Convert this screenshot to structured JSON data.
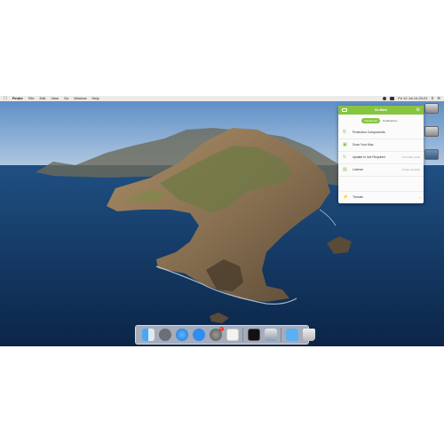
{
  "menubar": {
    "app_name": "Finder",
    "items": [
      "File",
      "Edit",
      "View",
      "Go",
      "Window",
      "Help"
    ],
    "clock": "Fri 12 Jul  14:23:21"
  },
  "drweb": {
    "title": "Dr.Web",
    "tabs": [
      "Dashboard",
      "Notifications"
    ],
    "rows": [
      {
        "label": "Protection Components",
        "meta": ""
      },
      {
        "label": "Scan Your Mac",
        "meta": ""
      },
      {
        "label": "Update Is Not Required",
        "meta": "15.07.2020, 16:30"
      },
      {
        "label": "License",
        "meta": "44 days remaining"
      },
      {
        "label": "Threats",
        "meta": ""
      }
    ],
    "accent": "#86c540"
  },
  "dock": {
    "icons": [
      "finder-icon",
      "launchpad-icon",
      "safari-icon",
      "app-store-icon",
      "system-preferences-icon",
      "drweb-icon",
      "terminal-icon",
      "preview-icon",
      "downloads-icon",
      "trash-icon"
    ],
    "system_preferences_badge": "1"
  }
}
